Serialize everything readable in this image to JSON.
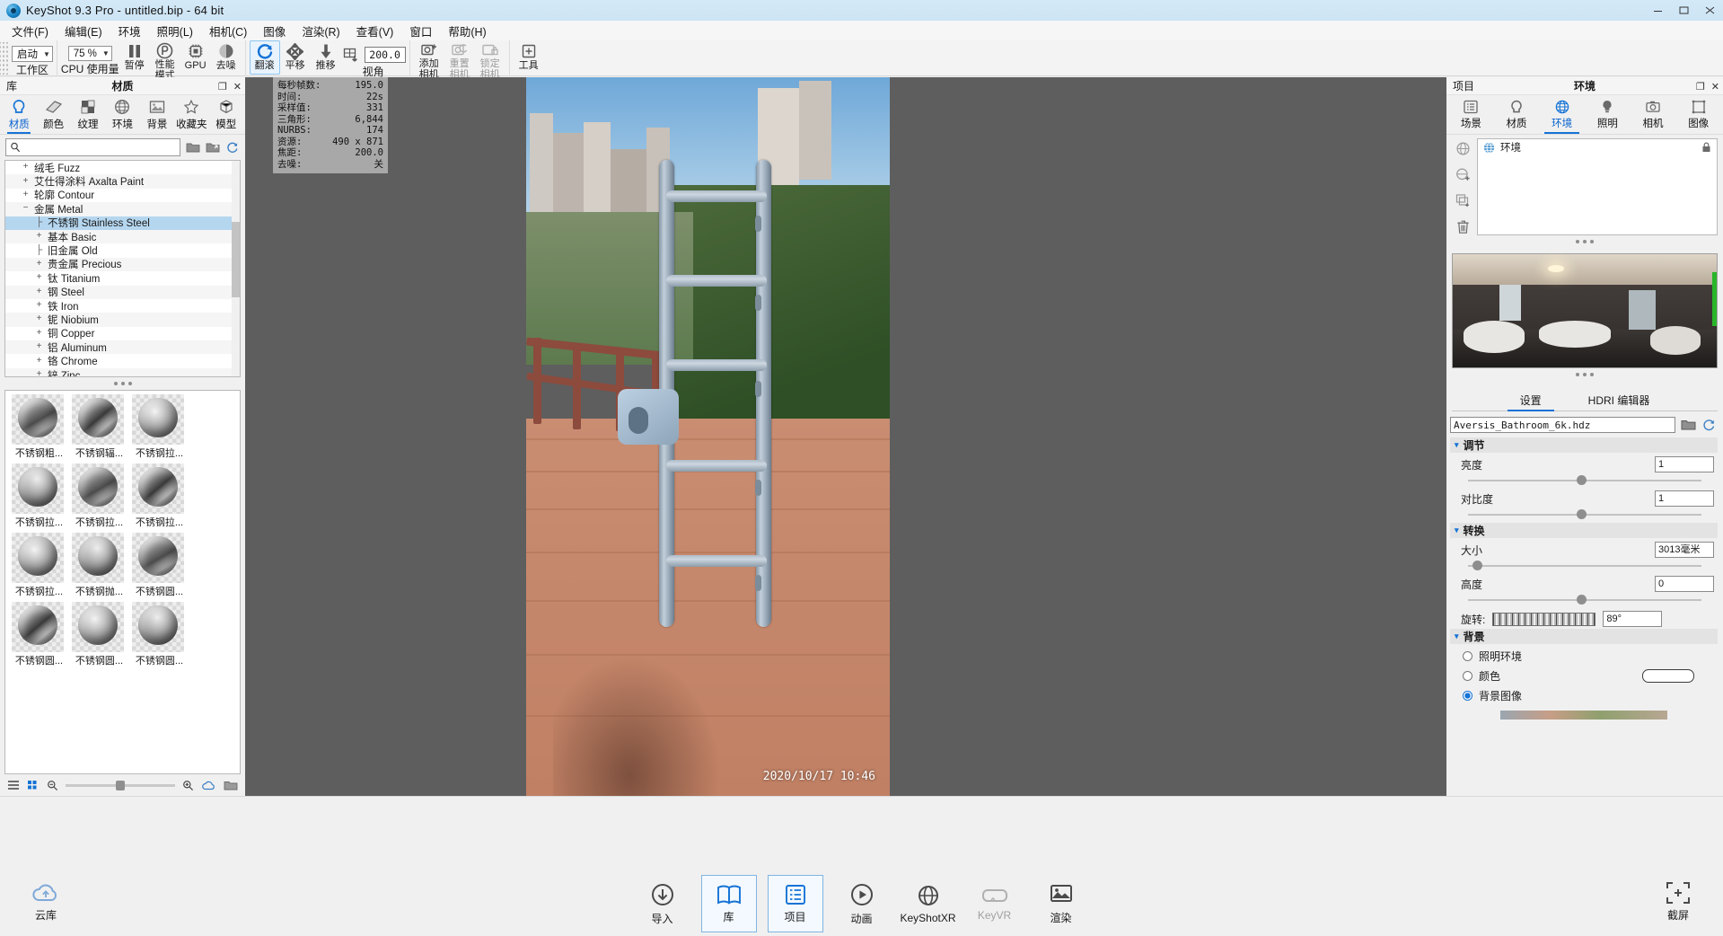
{
  "window": {
    "title": "KeyShot 9.3 Pro  - untitled.bip  - 64 bit",
    "minimize": "–",
    "maximize": "▢",
    "close": "✕"
  },
  "menubar": {
    "items": [
      "文件(F)",
      "编辑(E)",
      "环境",
      "照明(L)",
      "相机(C)",
      "图像",
      "渲染(R)",
      "查看(V)",
      "窗口",
      "帮助(H)"
    ]
  },
  "toolbar": {
    "workspace": {
      "label": "工作区",
      "value": "启动"
    },
    "cpu": {
      "label": "CPU 使用量",
      "value": "75 %"
    },
    "pause": {
      "label": "暂停",
      "icon": "pause-icon"
    },
    "performance": {
      "label": "性能\n模式",
      "line1": "性能",
      "line2": "模式",
      "icon": "performance-icon"
    },
    "gpu": {
      "label": "GPU",
      "icon": "gpu-icon"
    },
    "denoise": {
      "label": "去噪",
      "icon": "denoise-icon"
    },
    "orbit": {
      "label": "翻滚",
      "icon": "orbit-icon"
    },
    "pan": {
      "label": "平移",
      "icon": "pan-icon"
    },
    "dolly": {
      "label": "推移",
      "icon": "dolly-icon"
    },
    "perspective": {
      "label": "视角",
      "value": "200.0",
      "icon": "perspective-icon"
    },
    "add_camera": {
      "label": "添加\n相机",
      "line1": "添加",
      "line2": "相机",
      "icon": "add-camera-icon"
    },
    "reset_camera": {
      "label": "重置\n相机",
      "line1": "重置",
      "line2": "相机",
      "icon": "reset-camera-icon"
    },
    "lock_camera": {
      "label": "锁定\n相机",
      "line1": "锁定",
      "line2": "相机",
      "icon": "lock-camera-icon"
    },
    "tools": {
      "label": "工具",
      "icon": "tools-icon"
    }
  },
  "library": {
    "panel_left_label": "库",
    "panel_title": "材质",
    "undock": "❐",
    "close": "✕",
    "tabs": [
      {
        "label": "材质",
        "icon": "material-icon",
        "selected": true
      },
      {
        "label": "颜色",
        "icon": "color-icon",
        "selected": false
      },
      {
        "label": "纹理",
        "icon": "texture-icon",
        "selected": false
      },
      {
        "label": "环境",
        "icon": "environment-icon",
        "selected": false
      },
      {
        "label": "背景",
        "icon": "background-icon",
        "selected": false
      },
      {
        "label": "收藏夹",
        "icon": "favorites-icon",
        "selected": false
      },
      {
        "label": "模型",
        "icon": "model-icon",
        "selected": false
      }
    ],
    "search": {
      "placeholder": "",
      "value": "",
      "icon": "search-icon"
    },
    "search_buttons": [
      "folder-icon",
      "import-icon",
      "refresh-icon"
    ],
    "tree": [
      {
        "label": "绒毛 Fuzz",
        "toggle": "+",
        "depth": 0,
        "selected": false
      },
      {
        "label": "艾仕得涂料 Axalta Paint",
        "toggle": "+",
        "depth": 0,
        "selected": false
      },
      {
        "label": "轮廓 Contour",
        "toggle": "+",
        "depth": 0,
        "selected": false
      },
      {
        "label": "金属 Metal",
        "toggle": "−",
        "depth": 0,
        "selected": false
      },
      {
        "label": "不锈钢 Stainless Steel",
        "toggle": "",
        "depth": 1,
        "selected": true
      },
      {
        "label": "基本 Basic",
        "toggle": "+",
        "depth": 1,
        "selected": false
      },
      {
        "label": "旧金属 Old",
        "toggle": "",
        "depth": 1,
        "selected": false
      },
      {
        "label": "贵金属 Precious",
        "toggle": "+",
        "depth": 1,
        "selected": false
      },
      {
        "label": "钛 Titanium",
        "toggle": "+",
        "depth": 1,
        "selected": false
      },
      {
        "label": "钢 Steel",
        "toggle": "+",
        "depth": 1,
        "selected": false
      },
      {
        "label": "铁 Iron",
        "toggle": "+",
        "depth": 1,
        "selected": false
      },
      {
        "label": "铌 Niobium",
        "toggle": "+",
        "depth": 1,
        "selected": false
      },
      {
        "label": "铜 Copper",
        "toggle": "+",
        "depth": 1,
        "selected": false
      },
      {
        "label": "铝 Aluminum",
        "toggle": "+",
        "depth": 1,
        "selected": false
      },
      {
        "label": "铬 Chrome",
        "toggle": "+",
        "depth": 1,
        "selected": false
      },
      {
        "label": "锌 Zinc",
        "toggle": "+",
        "depth": 1,
        "selected": false
      }
    ],
    "thumbnails": [
      {
        "label": "不锈钢粗..."
      },
      {
        "label": "不锈钢辐..."
      },
      {
        "label": "不锈钢拉..."
      },
      {
        "label": "不锈钢拉..."
      },
      {
        "label": "不锈钢拉..."
      },
      {
        "label": "不锈钢拉..."
      },
      {
        "label": "不锈钢拉..."
      },
      {
        "label": "不锈钢抛..."
      },
      {
        "label": "不锈钢圆..."
      },
      {
        "label": "不锈钢圆..."
      },
      {
        "label": "不锈钢圆..."
      },
      {
        "label": "不锈钢圆..."
      }
    ],
    "footer_icons": [
      "list-view-icon",
      "grid-view-icon",
      "zoom-out-icon",
      "zoom-in-icon",
      "cloud-icon",
      "folder-open-icon"
    ]
  },
  "viewport": {
    "stats": [
      {
        "key": "每秒帧数:",
        "value": "195.0"
      },
      {
        "key": "时间:",
        "value": "22s"
      },
      {
        "key": "采样值:",
        "value": "331"
      },
      {
        "key": "三角形:",
        "value": "6,844"
      },
      {
        "key": "NURBS:",
        "value": "174"
      },
      {
        "key": "资源:",
        "value": "490 x 871"
      },
      {
        "key": "焦距:",
        "value": "200.0"
      },
      {
        "key": "去噪:",
        "value": "关"
      }
    ],
    "timestamp": "2020/10/17  10:46"
  },
  "project": {
    "panel_left_label": "项目",
    "panel_title": "环境",
    "undock": "❐",
    "close": "✕",
    "tabs": [
      {
        "label": "场景",
        "icon": "scene-icon",
        "selected": false
      },
      {
        "label": "材质",
        "icon": "material-icon",
        "selected": false
      },
      {
        "label": "环境",
        "icon": "environment-icon",
        "selected": true
      },
      {
        "label": "照明",
        "icon": "lighting-icon",
        "selected": false
      },
      {
        "label": "相机",
        "icon": "camera-icon",
        "selected": false
      },
      {
        "label": "图像",
        "icon": "image-icon",
        "selected": false
      }
    ],
    "side_tools": [
      "environment-sphere-icon",
      "add-environment-icon",
      "duplicate-environment-icon",
      "delete-icon"
    ],
    "list": [
      {
        "label": "环境",
        "icon": "environment-icon",
        "lock": "lock-icon"
      }
    ],
    "settings_tabs": [
      {
        "label": "设置",
        "selected": true
      },
      {
        "label": "HDRI 编辑器",
        "selected": false
      }
    ],
    "hdri_file": {
      "value": "Aversis_Bathroom_6k.hdz",
      "browse": "folder-icon",
      "refresh": "refresh-icon"
    },
    "sections": {
      "adjust": {
        "title": "调节",
        "caret": "▾",
        "controls": [
          {
            "label": "亮度",
            "value": "1",
            "slider_pct": 50
          },
          {
            "label": "对比度",
            "value": "1",
            "slider_pct": 50
          }
        ]
      },
      "transform": {
        "title": "转换",
        "caret": "▾",
        "controls": [
          {
            "label": "大小",
            "value": "3013毫米",
            "slider_pct": 7
          },
          {
            "label": "高度",
            "value": "0",
            "slider_pct": 50
          }
        ],
        "rotation": {
          "label": "旋转:",
          "value": "89°"
        }
      },
      "background": {
        "title": "背景",
        "caret": "▾",
        "options": [
          {
            "label": "照明环境",
            "selected": false
          },
          {
            "label": "颜色",
            "selected": false,
            "has_swatch": true
          },
          {
            "label": "背景图像",
            "selected": true
          }
        ]
      }
    }
  },
  "bottombar": {
    "cloud": {
      "label": "云库",
      "icon": "cloud-icon"
    },
    "items": [
      {
        "label": "导入",
        "icon": "import-icon",
        "boxed": false,
        "dim": false
      },
      {
        "label": "库",
        "icon": "library-book-icon",
        "boxed": true,
        "dim": false
      },
      {
        "label": "项目",
        "icon": "project-list-icon",
        "boxed": true,
        "dim": false
      },
      {
        "label": "动画",
        "icon": "animation-play-icon",
        "boxed": false,
        "dim": false
      },
      {
        "label": "KeyShotXR",
        "icon": "keyshotxr-icon",
        "boxed": false,
        "dim": false
      },
      {
        "label": "KeyVR",
        "icon": "keyvr-icon",
        "boxed": false,
        "dim": true
      },
      {
        "label": "渲染",
        "icon": "render-icon",
        "boxed": false,
        "dim": false
      }
    ],
    "screenshot": {
      "label": "截屏",
      "icon": "screenshot-icon"
    }
  },
  "colors": {
    "accent": "#1573d6",
    "selection": "#b5d6ef",
    "titlebar": "#d4e9f7",
    "viewport_bg": "#5e5e5e",
    "stats_bg": "#a8a8a8",
    "panel_bg": "#f0f0f0"
  }
}
